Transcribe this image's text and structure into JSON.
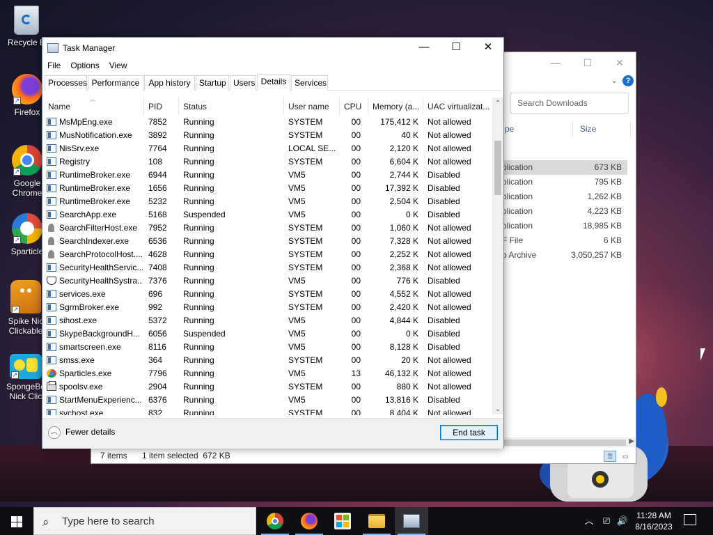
{
  "desktop": {
    "icons": [
      {
        "label": "Recycle Bin",
        "shown": "Recycle B"
      },
      {
        "label": "Firefox"
      },
      {
        "label": "Google Chrome",
        "line1": "Google",
        "line2": "Chrome"
      },
      {
        "label": "Sparticles",
        "shown": "Sparticle"
      },
      {
        "label": "Spike Nick Clickable",
        "line1": "Spike Nic",
        "line2": "Clickable"
      },
      {
        "label": "SpongeBob Nick Clickable",
        "line1": "SpongeBo",
        "line2": "Nick Clic"
      }
    ]
  },
  "explorer": {
    "search_placeholder": "Search Downloads",
    "columns": {
      "type": "pe",
      "size": "Size"
    },
    "rows": [
      {
        "type": "plication",
        "size": "673 KB",
        "selected": true
      },
      {
        "type": "plication",
        "size": "795 KB"
      },
      {
        "type": "plication",
        "size": "1,262 KB"
      },
      {
        "type": "plication",
        "size": "4,223 KB"
      },
      {
        "type": "plication",
        "size": "18,985 KB"
      },
      {
        "type": "F File",
        "size": "6 KB"
      },
      {
        "type": "p Archive",
        "size": "3,050,257 KB"
      }
    ],
    "status": {
      "items": "7 items",
      "selection": "1 item selected  672 KB"
    }
  },
  "taskmanager": {
    "title": "Task Manager",
    "menu": [
      "File",
      "Options",
      "View"
    ],
    "tabs": [
      "Processes",
      "Performance",
      "App history",
      "Startup",
      "Users",
      "Details",
      "Services"
    ],
    "active_tab": "Details",
    "columns": [
      "Name",
      "PID",
      "Status",
      "User name",
      "CPU",
      "Memory (a...",
      "UAC virtualizat..."
    ],
    "processes": [
      {
        "name": "MsMpEng.exe",
        "pid": "7852",
        "status": "Running",
        "user": "SYSTEM",
        "cpu": "00",
        "mem": "175,412 K",
        "uac": "Not allowed",
        "icon": "app"
      },
      {
        "name": "MusNotification.exe",
        "pid": "3892",
        "status": "Running",
        "user": "SYSTEM",
        "cpu": "00",
        "mem": "40 K",
        "uac": "Not allowed",
        "icon": "app"
      },
      {
        "name": "NisSrv.exe",
        "pid": "7764",
        "status": "Running",
        "user": "LOCAL SE...",
        "cpu": "00",
        "mem": "2,120 K",
        "uac": "Not allowed",
        "icon": "app"
      },
      {
        "name": "Registry",
        "pid": "108",
        "status": "Running",
        "user": "SYSTEM",
        "cpu": "00",
        "mem": "6,604 K",
        "uac": "Not allowed",
        "icon": "app"
      },
      {
        "name": "RuntimeBroker.exe",
        "pid": "6944",
        "status": "Running",
        "user": "VM5",
        "cpu": "00",
        "mem": "2,744 K",
        "uac": "Disabled",
        "icon": "app"
      },
      {
        "name": "RuntimeBroker.exe",
        "pid": "1656",
        "status": "Running",
        "user": "VM5",
        "cpu": "00",
        "mem": "17,392 K",
        "uac": "Disabled",
        "icon": "app"
      },
      {
        "name": "RuntimeBroker.exe",
        "pid": "5232",
        "status": "Running",
        "user": "VM5",
        "cpu": "00",
        "mem": "2,504 K",
        "uac": "Disabled",
        "icon": "app"
      },
      {
        "name": "SearchApp.exe",
        "pid": "5168",
        "status": "Suspended",
        "user": "VM5",
        "cpu": "00",
        "mem": "0 K",
        "uac": "Disabled",
        "icon": "app"
      },
      {
        "name": "SearchFilterHost.exe",
        "pid": "7952",
        "status": "Running",
        "user": "SYSTEM",
        "cpu": "00",
        "mem": "1,060 K",
        "uac": "Not allowed",
        "icon": "person"
      },
      {
        "name": "SearchIndexer.exe",
        "pid": "6536",
        "status": "Running",
        "user": "SYSTEM",
        "cpu": "00",
        "mem": "7,328 K",
        "uac": "Not allowed",
        "icon": "person"
      },
      {
        "name": "SearchProtocolHost....",
        "pid": "4628",
        "status": "Running",
        "user": "SYSTEM",
        "cpu": "00",
        "mem": "2,252 K",
        "uac": "Not allowed",
        "icon": "person"
      },
      {
        "name": "SecurityHealthServic...",
        "pid": "7408",
        "status": "Running",
        "user": "SYSTEM",
        "cpu": "00",
        "mem": "2,368 K",
        "uac": "Not allowed",
        "icon": "app"
      },
      {
        "name": "SecurityHealthSystra...",
        "pid": "7376",
        "status": "Running",
        "user": "VM5",
        "cpu": "00",
        "mem": "776 K",
        "uac": "Disabled",
        "icon": "shield"
      },
      {
        "name": "services.exe",
        "pid": "696",
        "status": "Running",
        "user": "SYSTEM",
        "cpu": "00",
        "mem": "4,552 K",
        "uac": "Not allowed",
        "icon": "app"
      },
      {
        "name": "SgrmBroker.exe",
        "pid": "992",
        "status": "Running",
        "user": "SYSTEM",
        "cpu": "00",
        "mem": "2,420 K",
        "uac": "Not allowed",
        "icon": "app"
      },
      {
        "name": "sihost.exe",
        "pid": "5372",
        "status": "Running",
        "user": "VM5",
        "cpu": "00",
        "mem": "4,844 K",
        "uac": "Disabled",
        "icon": "app"
      },
      {
        "name": "SkypeBackgroundH...",
        "pid": "6056",
        "status": "Suspended",
        "user": "VM5",
        "cpu": "00",
        "mem": "0 K",
        "uac": "Disabled",
        "icon": "app"
      },
      {
        "name": "smartscreen.exe",
        "pid": "8116",
        "status": "Running",
        "user": "VM5",
        "cpu": "00",
        "mem": "8,128 K",
        "uac": "Disabled",
        "icon": "app"
      },
      {
        "name": "smss.exe",
        "pid": "364",
        "status": "Running",
        "user": "SYSTEM",
        "cpu": "00",
        "mem": "20 K",
        "uac": "Not allowed",
        "icon": "app"
      },
      {
        "name": "Sparticles.exe",
        "pid": "7796",
        "status": "Running",
        "user": "VM5",
        "cpu": "13",
        "mem": "46,132 K",
        "uac": "Not allowed",
        "icon": "chrome"
      },
      {
        "name": "spoolsv.exe",
        "pid": "2904",
        "status": "Running",
        "user": "SYSTEM",
        "cpu": "00",
        "mem": "880 K",
        "uac": "Not allowed",
        "icon": "printer"
      },
      {
        "name": "StartMenuExperienc...",
        "pid": "6376",
        "status": "Running",
        "user": "VM5",
        "cpu": "00",
        "mem": "13,816 K",
        "uac": "Disabled",
        "icon": "app"
      },
      {
        "name": "svchost.exe",
        "pid": "832",
        "status": "Running",
        "user": "SYSTEM",
        "cpu": "00",
        "mem": "8,404 K",
        "uac": "Not allowed",
        "icon": "app"
      }
    ],
    "footer": {
      "fewer_details": "Fewer details",
      "end_task": "End task"
    }
  },
  "taskbar": {
    "search_placeholder": "Type here to search",
    "apps": [
      "chrome",
      "firefox",
      "store",
      "file-explorer",
      "task-manager"
    ],
    "time": "11:28 AM",
    "date": "8/16/2023"
  },
  "colors": {
    "accent": "#0078d7",
    "taskbar": "#101014",
    "selection": "#d9d9d9"
  }
}
